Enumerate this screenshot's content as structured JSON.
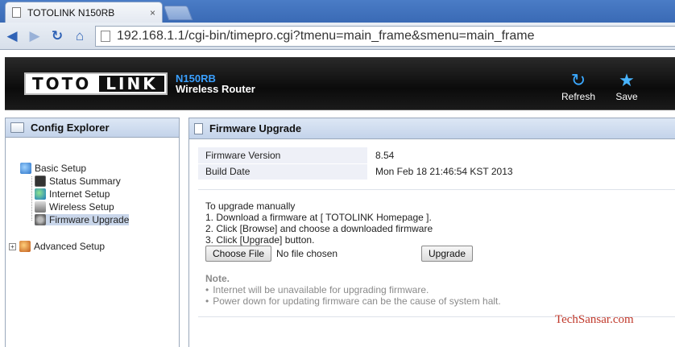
{
  "browser": {
    "tab_title": "TOTOLINK N150RB",
    "tab_close": "×",
    "url": "192.168.1.1/cgi-bin/timepro.cgi?tmenu=main_frame&smenu=main_frame",
    "back": "◀",
    "forward": "▶",
    "reload": "↻",
    "home": "⌂"
  },
  "header": {
    "logo_left": "TOTO",
    "logo_right": "LINK",
    "model": "N150RB",
    "product": "Wireless Router",
    "refresh_label": "Refresh",
    "save_label": "Save",
    "refresh_icon": "↻",
    "save_icon": "★"
  },
  "sidebar": {
    "title": "Config Explorer",
    "basic_setup": "Basic Setup",
    "items": [
      {
        "label": "Status Summary"
      },
      {
        "label": "Internet Setup"
      },
      {
        "label": "Wireless Setup"
      },
      {
        "label": "Firmware Upgrade"
      }
    ],
    "advanced_setup": "Advanced Setup",
    "expander": "+"
  },
  "main": {
    "title": "Firmware Upgrade",
    "info": [
      {
        "label": "Firmware Version",
        "value": "8.54"
      },
      {
        "label": "Build Date",
        "value": "Mon Feb 18 21:46:54 KST 2013"
      }
    ],
    "instructions": [
      "To upgrade manually",
      "1. Download a firmware at [ TOTOLINK Homepage ].",
      "2. Click [Browse] and choose a downloaded firmware",
      "3. Click [Upgrade] button."
    ],
    "choose_file_label": "Choose File",
    "no_file_text": "No file chosen",
    "upgrade_label": "Upgrade",
    "note_title": "Note.",
    "notes": [
      "Internet will be unavailable for upgrading firmware.",
      "Power down for updating firmware can be the cause of system halt."
    ]
  },
  "watermark": "TechSansar.com"
}
